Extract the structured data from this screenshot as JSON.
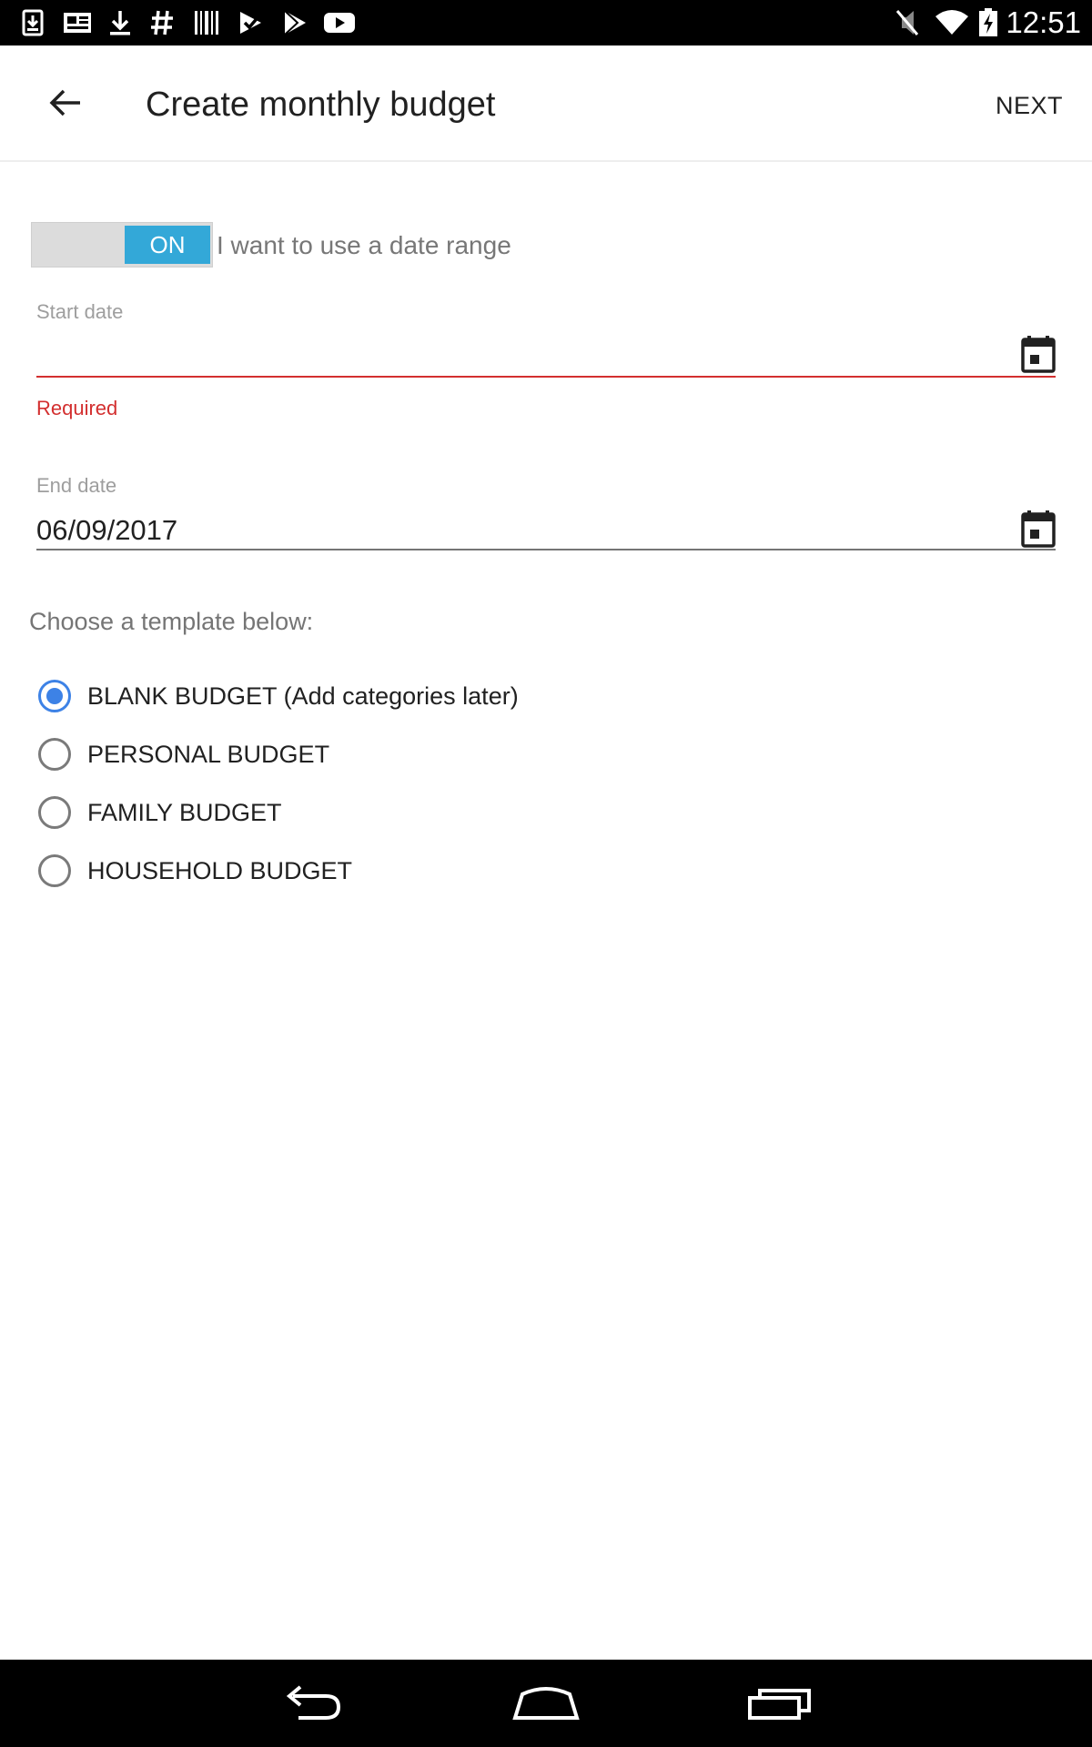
{
  "status_bar": {
    "time": "12:51",
    "left_icons": [
      "download-box-icon",
      "news-icon",
      "download-icon",
      "hashtag-icon",
      "barcode-icon",
      "check-flag-icon",
      "play-store-icon",
      "youtube-icon"
    ],
    "right_icons": [
      "mute-icon",
      "wifi-icon",
      "battery-charging-icon"
    ]
  },
  "toolbar": {
    "title": "Create monthly budget",
    "next_label": "NEXT"
  },
  "date_range": {
    "toggle_state": "ON",
    "label": "I want to use a date range"
  },
  "start_date": {
    "label": "Start date",
    "value": "",
    "error": "Required"
  },
  "end_date": {
    "label": "End date",
    "value": "06/09/2017"
  },
  "templates": {
    "prompt": "Choose a template below:",
    "options": [
      {
        "label": "BLANK BUDGET (Add categories later)",
        "checked": true
      },
      {
        "label": "PERSONAL BUDGET",
        "checked": false
      },
      {
        "label": "FAMILY BUDGET",
        "checked": false
      },
      {
        "label": "HOUSEHOLD BUDGET",
        "checked": false
      }
    ]
  },
  "colors": {
    "accent": "#3d82e6",
    "toggle_on": "#33a8d8",
    "error": "#d32f2f"
  },
  "nav_bar": [
    "back-nav-icon",
    "home-nav-icon",
    "recents-nav-icon"
  ]
}
